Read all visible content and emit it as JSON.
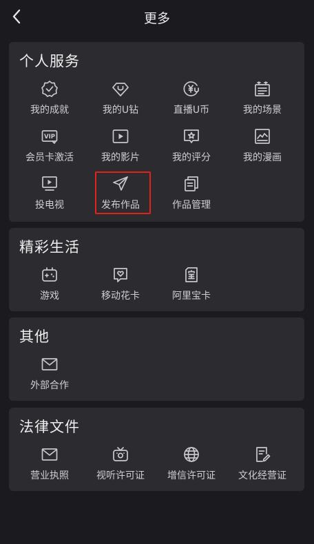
{
  "header": {
    "title": "更多",
    "back_icon": "chevron-left-icon"
  },
  "sections": [
    {
      "title": "个人服务",
      "items": [
        {
          "label": "我的成就",
          "icon": "achievement-badge-icon"
        },
        {
          "label": "我的U钻",
          "icon": "u-diamond-icon"
        },
        {
          "label": "直播U币",
          "icon": "u-coin-icon"
        },
        {
          "label": "我的场景",
          "icon": "scene-icon"
        },
        {
          "label": "会员卡激活",
          "icon": "vip-card-icon"
        },
        {
          "label": "我的影片",
          "icon": "movie-play-icon"
        },
        {
          "label": "我的评分",
          "icon": "rating-star-icon"
        },
        {
          "label": "我的漫画",
          "icon": "comic-icon"
        },
        {
          "label": "投电视",
          "icon": "tv-cast-icon"
        },
        {
          "label": "发布作品",
          "icon": "send-paper-plane-icon"
        },
        {
          "label": "作品管理",
          "icon": "works-manage-icon"
        }
      ]
    },
    {
      "title": "精彩生活",
      "items": [
        {
          "label": "游戏",
          "icon": "game-controller-icon"
        },
        {
          "label": "移动花卡",
          "icon": "mobile-flower-card-icon"
        },
        {
          "label": "阿里宝卡",
          "icon": "ali-bao-card-icon"
        }
      ]
    },
    {
      "title": "其他",
      "items": [
        {
          "label": "外部合作",
          "icon": "mail-icon"
        }
      ]
    },
    {
      "title": "法律文件",
      "items": [
        {
          "label": "营业执照",
          "icon": "mail-icon"
        },
        {
          "label": "视听许可证",
          "icon": "tv-broadcast-icon"
        },
        {
          "label": "增信许可证",
          "icon": "globe-icon"
        },
        {
          "label": "文化经营证",
          "icon": "document-edit-icon"
        }
      ]
    }
  ],
  "highlight_color": "#e0241c"
}
